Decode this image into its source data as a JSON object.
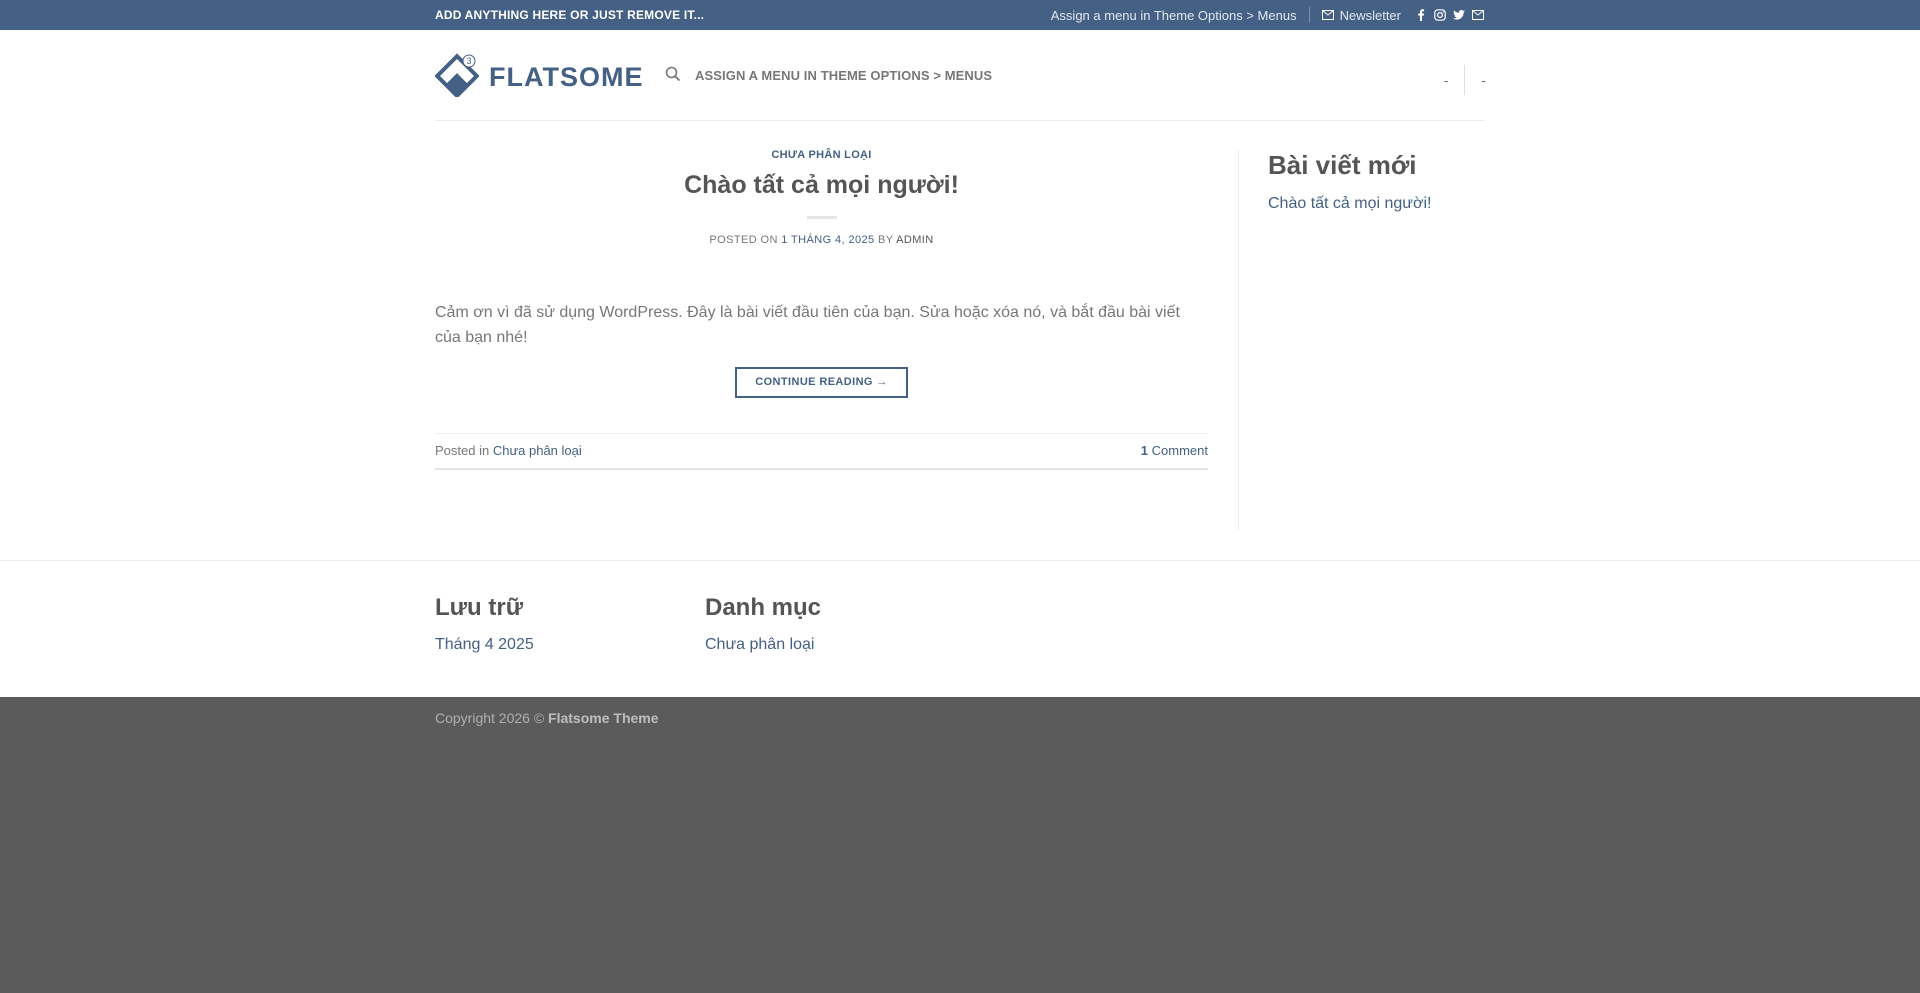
{
  "colors": {
    "primary": "#446084",
    "footer_bg": "#5b5b5b",
    "text": "#777777"
  },
  "topbar": {
    "left_text": "ADD ANYTHING HERE OR JUST REMOVE IT...",
    "menu_hint": "Assign a menu in Theme Options > Menus",
    "newsletter": "Newsletter",
    "social_icons": [
      "facebook-icon",
      "instagram-icon",
      "twitter-icon",
      "email-icon"
    ]
  },
  "header": {
    "logo_text": "FLATSOME",
    "logo_badge": "3",
    "nav_hint": "ASSIGN A MENU IN THEME OPTIONS > MENUS",
    "right_items": [
      "-",
      "-"
    ]
  },
  "post": {
    "category": "CHƯA PHÂN LOẠI",
    "title": "Chào tất cả mọi người!",
    "meta_prefix": "POSTED ON",
    "date": "1 THÁNG 4, 2025",
    "meta_by": "BY",
    "author": "ADMIN",
    "excerpt": "Cảm ơn vì đã sử dụng WordPress. Đây là bài viết đầu tiên của bạn. Sửa hoặc xóa nó, và bắt đầu bài viết của bạn nhé!",
    "continue_label": "CONTINUE READING →",
    "posted_in_label": "Posted in",
    "posted_in_cat": "Chưa phân loại",
    "comments_count": "1",
    "comments_label": "Comment"
  },
  "sidebar": {
    "title": "Bài viết mới",
    "items": [
      "Chào tất cả mọi người!"
    ]
  },
  "footer_widgets": {
    "archive": {
      "title": "Lưu trữ",
      "items": [
        "Tháng 4 2025"
      ]
    },
    "categories": {
      "title": "Danh mục",
      "items": [
        "Chưa phân loại"
      ]
    }
  },
  "footer": {
    "copyright_prefix": "Copyright 2026 ©",
    "brand": "Flatsome Theme"
  }
}
